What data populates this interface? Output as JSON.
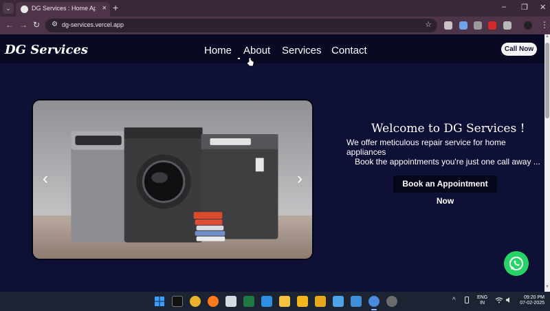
{
  "browser": {
    "tab_title": "DG Services : Home Appliances",
    "tab_close": "×",
    "new_tab": "+",
    "address": "dg-services.vercel.app",
    "minimize": "–",
    "restore": "❐",
    "close": "✕",
    "back": "←",
    "forward": "→",
    "reload": "↻",
    "tune": "⚙",
    "star": "☆",
    "menu": "⋮",
    "tab_list": "⌄"
  },
  "site": {
    "brand": "DG Services",
    "nav": [
      "Home",
      "About",
      "Services",
      "Contact"
    ],
    "call_button": "Call Now",
    "carousel": {
      "prev": "‹",
      "next": "›"
    },
    "hero": {
      "title": "Welcome to DG Services !",
      "description": "We offer meticulous repair service for home appliances",
      "subtext": "Book the appointments you're just one call away ...",
      "cta": "Book an Appointment Now"
    }
  },
  "scrollbar": {
    "up": "▲",
    "down": "▼"
  },
  "taskbar": {
    "language_line1": "ENG",
    "language_line2": "IN",
    "time": "09:20 PM",
    "date": "07-02-2025",
    "tray_chevron": "^"
  },
  "colors": {
    "page_background": "#0e1035",
    "navbar": "#080a24",
    "whatsapp": "#25d366"
  }
}
